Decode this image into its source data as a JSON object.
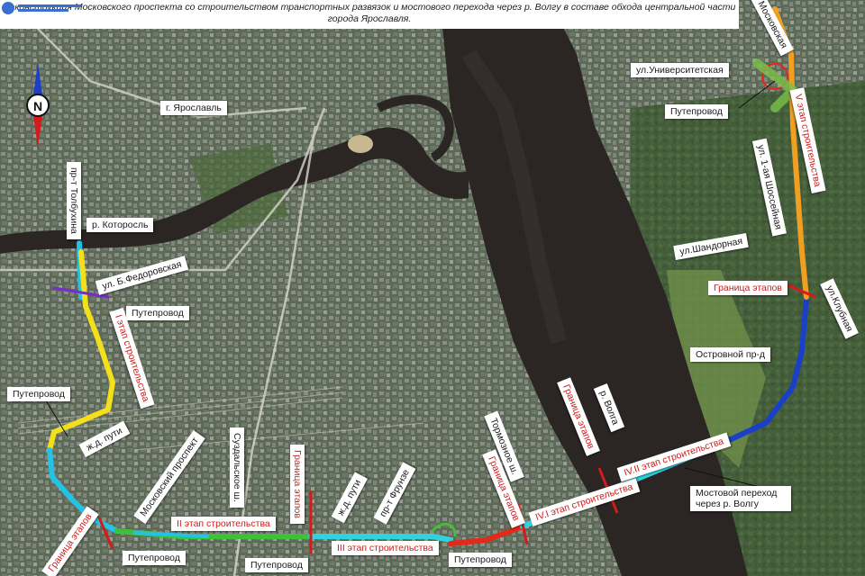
{
  "title": "Реконструкция Московского проспекта со строительством транспортных развязок и мостового перехода через р. Волгу в составе обхода центральной части города Ярославля.",
  "compass": {
    "north_letter": "N",
    "icon": "compass-rose-icon"
  },
  "labels": {
    "city": "г. Ярославль",
    "river_kotorosl": "р. Которосль",
    "pr_tolbukhina": "пр-т Толбухина",
    "ul_fedorovskaya": "ул. Б.Федоровская",
    "putoprovod_1": "Путепровод",
    "etap_1": "I этап строительства",
    "putoprovod_2": "Путепровод",
    "zhd_puti_1": "ж.д. пути",
    "moskovsky_prospekt": "Московский проспект",
    "granitsa_etapov_1": "Граница этапов",
    "putoprovod_3": "Путепровод",
    "etap_2": "II этап строительства",
    "suzdalskoe_sh": "Суздальское ш.",
    "putoprovod_4": "Путепровод",
    "granitsa_etapov_2": "Граница этапов",
    "zhd_puti_2": "ж.д. пути",
    "pr_frunze": "пр-т Фрунзе",
    "etap_3": "III этап строительства",
    "putoprovod_5": "Путепровод",
    "tormoznoe_sh": "Тормозное ш.",
    "granitsa_etapov_3": "Граница этапов",
    "etap_4_1": "IV.I этап строительства",
    "granitsa_etapov_4": "Граница этапов",
    "river_volga": "р. Волга",
    "etap_4_2": "IV.II этап строительства",
    "mostovoy_perekhod": "Мостовой переход через р. Волгу",
    "ostrovnoy_pr": "Островной пр-д",
    "ul_klubnaya": "ул.Клубная",
    "granitsa_etapov_5": "Граница этапов",
    "ul_shandornaya": "ул.Шандорная",
    "ul_shosseynaya": "ул. 1-ая Шоссейная",
    "etap_5": "V этап строительства",
    "putoprovod_6": "Путепровод",
    "ul_universitetskaya": "ул.Университетская",
    "ul_moskovskaya": "ул. Московская"
  },
  "colors": {
    "stage_1": "#f3e01a",
    "stage_1_ends": "#22c3e6",
    "stage_2": "#3fbf3a",
    "stage_3": "#2fd3e0",
    "stage_3_end": "#e22a1a",
    "stage_4_1": "#2fd3e0",
    "stage_4_2": "#1a3fc8",
    "stage_5": "#f0a020",
    "boundary": "#d61a1a",
    "river": "#2b2524",
    "label_red": "#d11a1a"
  }
}
